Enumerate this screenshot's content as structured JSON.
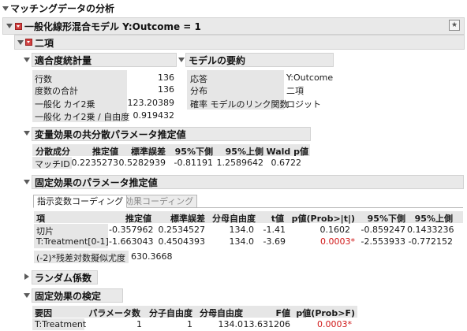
{
  "report": {
    "top_title": "マッチングデータの分析",
    "model_title": "一般化線形混合モデル Y:Outcome = 1",
    "binomial_title": "二項"
  },
  "fit_stats": {
    "title": "適合度統計量",
    "rows": [
      {
        "label": "行数",
        "value": "136"
      },
      {
        "label": "度数の合計",
        "value": "136"
      },
      {
        "label": "一般化 カイ2乗",
        "value": "123.20389"
      },
      {
        "label": "一般化 カイ2乗 / 自由度",
        "value": "0.919432"
      }
    ]
  },
  "model_summary": {
    "title": "モデルの要約",
    "rows": [
      {
        "label": "応答",
        "value": "Y:Outcome"
      },
      {
        "label": "分布",
        "value": "二項"
      },
      {
        "label": "確率 モデルのリンク関数",
        "value": "ロジット"
      }
    ]
  },
  "random_cov": {
    "title": "変量効果の共分散パラメータ推定値",
    "headers": [
      "分散成分",
      "推定値",
      "標準誤差",
      "95%下側",
      "95%上側",
      "Wald p値"
    ],
    "row": [
      "マッチID",
      "0.2235273",
      "0.5282939",
      "-0.81191",
      "1.2589642",
      "0.6722"
    ]
  },
  "fixed_params": {
    "title": "固定効果のパラメータ推定値",
    "tabs": [
      "指示変数コーディング",
      "効果コーディング"
    ],
    "headers": [
      "項",
      "推定値",
      "標準誤差",
      "分母自由度",
      "t値",
      "p値(Prob>|t|)",
      "95%下側",
      "95%上側"
    ],
    "rows": [
      [
        "切片",
        "-0.357962",
        "0.2534527",
        "134.0",
        "-1.41",
        "0.1602",
        "-0.859247",
        "0.1433236"
      ],
      [
        "T:Treatment[0-1]",
        "-1.663043",
        "0.4504393",
        "134.0",
        "-3.69",
        "0.0003*",
        "-2.553933",
        "-0.772152"
      ]
    ],
    "loglik_label": "(-2)*残差対数擬似尤度",
    "loglik_value": "630.3668"
  },
  "random_coef": {
    "title": "ランダム係数"
  },
  "fixed_tests": {
    "title": "固定効果の検定",
    "headers": [
      "要因",
      "パラメータ数",
      "分子自由度",
      "分母自由度",
      "F値",
      "p値(Prob>F)"
    ],
    "row": [
      "T:Treatment",
      "1",
      "1",
      "134.0",
      "13.631206",
      "0.0003*"
    ]
  },
  "colors": {
    "significant": "#d01818",
    "header_bg": "#e9e9e9",
    "red_button": "#d04040"
  }
}
